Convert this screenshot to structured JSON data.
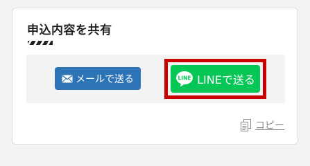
{
  "section": {
    "title": "申込内容を共有"
  },
  "share": {
    "mail_button_label": "メールで送る",
    "line_button_label": "LINEで送る",
    "line_badge_text": "LINE"
  },
  "copy": {
    "label": "コピー"
  },
  "icons": {
    "mail": "envelope-icon",
    "line": "line-logo-icon",
    "copy": "copy-document-icon"
  },
  "colors": {
    "mail_button": "#2c74b5",
    "line_button": "#06c755",
    "highlight_border": "#c80000",
    "panel_background": "#f3f3f3"
  }
}
